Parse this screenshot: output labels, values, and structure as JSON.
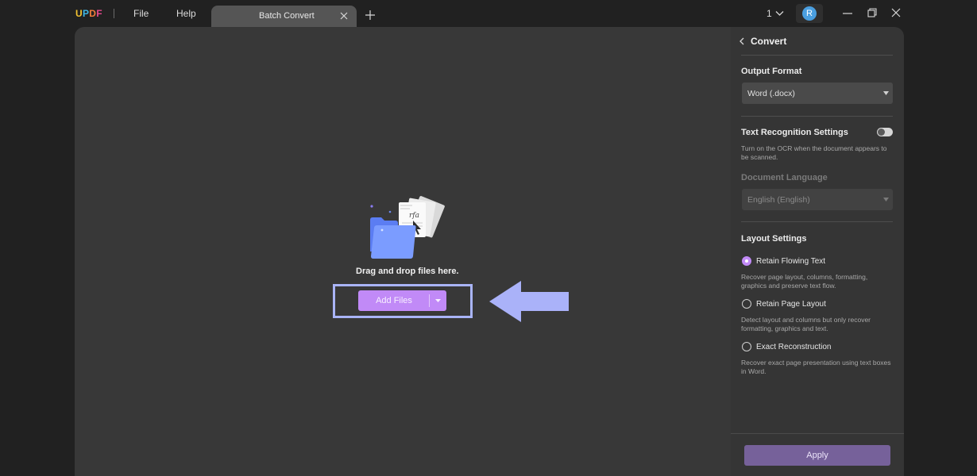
{
  "app": {
    "logo": "UPDF",
    "logo_colors": [
      "#f4c431",
      "#3fb8e6",
      "#f27d3a",
      "#e5498d"
    ]
  },
  "menu": {
    "file": "File",
    "help": "Help"
  },
  "tabs": [
    {
      "label": "Batch Convert"
    }
  ],
  "header_right": {
    "page_count": "1",
    "avatar_initial": "R"
  },
  "dropzone": {
    "hint": "Drag and drop files here.",
    "add_files_label": "Add Files"
  },
  "panel": {
    "title": "Convert",
    "output_format": {
      "label": "Output Format",
      "value": "Word (.docx)"
    },
    "text_recognition": {
      "label": "Text Recognition Settings",
      "enabled": false,
      "help": "Turn on the OCR when the document appears to be scanned."
    },
    "document_language": {
      "label": "Document Language",
      "value": "English (English)"
    },
    "layout": {
      "label": "Layout Settings",
      "options": [
        {
          "label": "Retain Flowing Text",
          "help": "Recover page layout, columns, formatting, graphics and preserve text flow.",
          "checked": true
        },
        {
          "label": "Retain Page Layout",
          "help": "Detect layout and columns but only recover formatting, graphics and text.",
          "checked": false
        },
        {
          "label": "Exact Reconstruction",
          "help": "Recover exact page presentation using text boxes in Word.",
          "checked": false
        }
      ]
    },
    "apply_label": "Apply"
  },
  "colors": {
    "accent": "#c18af7",
    "apply": "#76619a",
    "highlight": "#a9b4f7"
  }
}
